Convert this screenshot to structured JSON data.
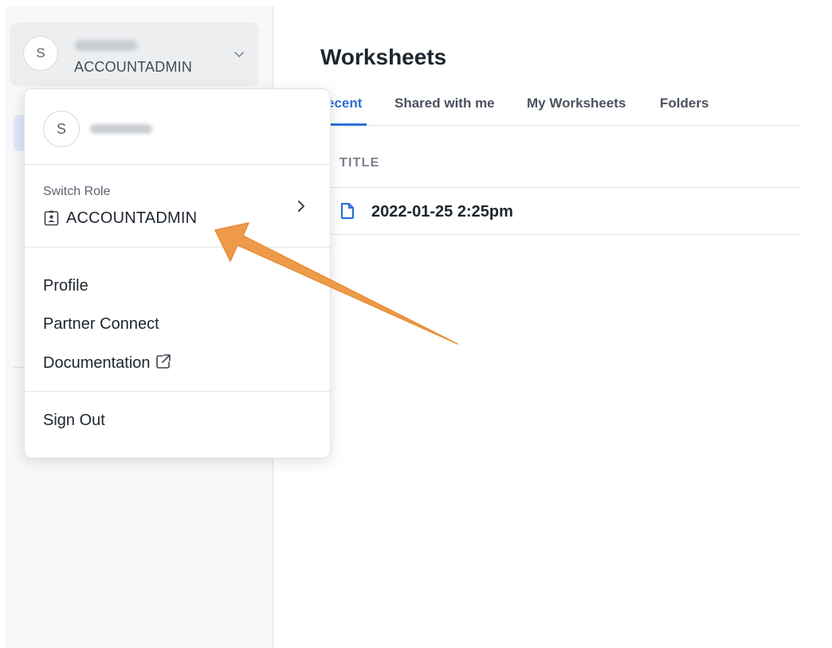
{
  "sidebar": {
    "account": {
      "avatar_initial": "S",
      "role": "ACCOUNTADMIN"
    }
  },
  "main": {
    "title": "Worksheets",
    "tabs": [
      {
        "label": "ecent",
        "active": true
      },
      {
        "label": "Shared with me",
        "active": false
      },
      {
        "label": "My Worksheets",
        "active": false
      },
      {
        "label": "Folders",
        "active": false
      }
    ],
    "table": {
      "column_header": "TITLE",
      "rows": [
        {
          "title": "2022-01-25 2:25pm"
        }
      ]
    }
  },
  "menu": {
    "avatar_initial": "S",
    "switch_role_label": "Switch Role",
    "current_role": "ACCOUNTADMIN",
    "items": [
      {
        "label": "Profile"
      },
      {
        "label": "Partner Connect"
      },
      {
        "label": "Documentation"
      }
    ],
    "sign_out": "Sign Out"
  },
  "icons": {
    "account_chevron": "chevron-down-icon",
    "role": "role-badge-icon",
    "switch_role_arrow": "chevron-right-icon",
    "external_link": "external-link-icon",
    "file": "file-icon"
  },
  "colors": {
    "accent": "#2f6fd6",
    "annotation_arrow": "#ee9a48"
  }
}
